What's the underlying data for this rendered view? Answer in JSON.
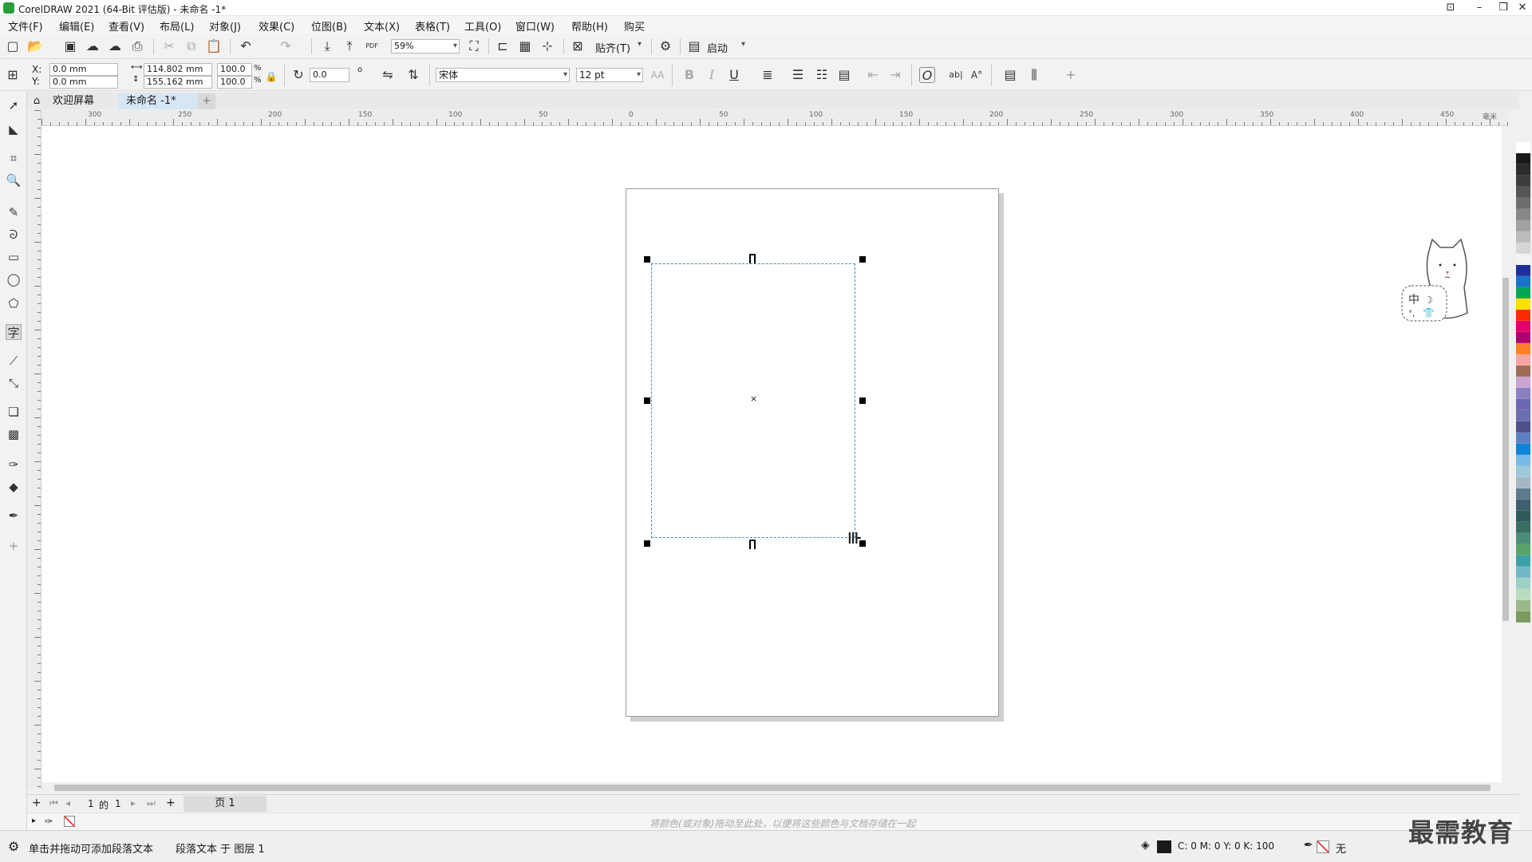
{
  "window": {
    "title": "CorelDRAW 2021 (64-Bit 评估版) - 未命名 -1*"
  },
  "menu": [
    "文件(F)",
    "编辑(E)",
    "查看(V)",
    "布局(L)",
    "对象(J)",
    "效果(C)",
    "位图(B)",
    "文本(X)",
    "表格(T)",
    "工具(O)",
    "窗口(W)",
    "帮助(H)",
    "购买"
  ],
  "toolbar": {
    "zoom": "59%",
    "snap_label": "贴齐(T)",
    "launch_label": "启动",
    "pdf_label": "PDF"
  },
  "property_bar": {
    "x_label": "X:",
    "y_label": "Y:",
    "x": "0.0 mm",
    "y": "0.0 mm",
    "width": "114.802 mm",
    "height": "155.162 mm",
    "scale_w": "100.0",
    "scale_h": "100.0",
    "percent": "%",
    "rotation": "0.0",
    "degree": "o",
    "font": "宋体",
    "font_size": "12 pt",
    "bold": "B",
    "italic": "I",
    "underline": "U"
  },
  "tabs": [
    {
      "label": "欢迎屏幕"
    },
    {
      "label": "未命名 -1*"
    }
  ],
  "ruler": {
    "ticks": [
      "300",
      "250",
      "200",
      "150",
      "100",
      "50",
      "0",
      "50",
      "100",
      "150",
      "200",
      "250",
      "300",
      "350",
      "400",
      "450"
    ],
    "unit": "毫米"
  },
  "page_nav": {
    "current": "1",
    "of_label": "的",
    "total": "1",
    "page_tab": "页 1"
  },
  "hint": "将颜色(或对象)拖动至此处，以便将这些颜色与文档存储在一起",
  "status": {
    "message": "单击并拖动可添加段落文本",
    "object_info": "段落文本 于 图层 1",
    "cmyk": "C:  0 M:  0 Y:  0 K:  100",
    "fill_none": "无"
  },
  "mascot_text": "中",
  "brand": "最需教育",
  "palette_colors": [
    "#ffffff",
    "#1a1a1a",
    "#2b2b2b",
    "#3d3d3d",
    "#555555",
    "#6e6e6e",
    "#888888",
    "#a1a1a1",
    "#bcbcbc",
    "#d6d6d6",
    "#f2f2f2",
    "#1f2f9c",
    "#1a73c9",
    "#00a651",
    "#ffe000",
    "#ff2a00",
    "#e2006a",
    "#b0006e",
    "#ff7f27",
    "#f5a3a3",
    "#9e6b55",
    "#c9a4d1",
    "#8b7fbf",
    "#6d69b0",
    "#6a6db0",
    "#4f4f8a",
    "#5e7fc1",
    "#0f84d6",
    "#7ab9e6",
    "#9cc9d9",
    "#a5b7c5",
    "#5c7a8a",
    "#3f5f6e",
    "#2f5a5a",
    "#3a6e63",
    "#4c8c7a",
    "#5aa46c",
    "#3fa1a8",
    "#73b8c8",
    "#9ed1c6",
    "#b8dcc0",
    "#9bb88a",
    "#7a9a5e"
  ]
}
